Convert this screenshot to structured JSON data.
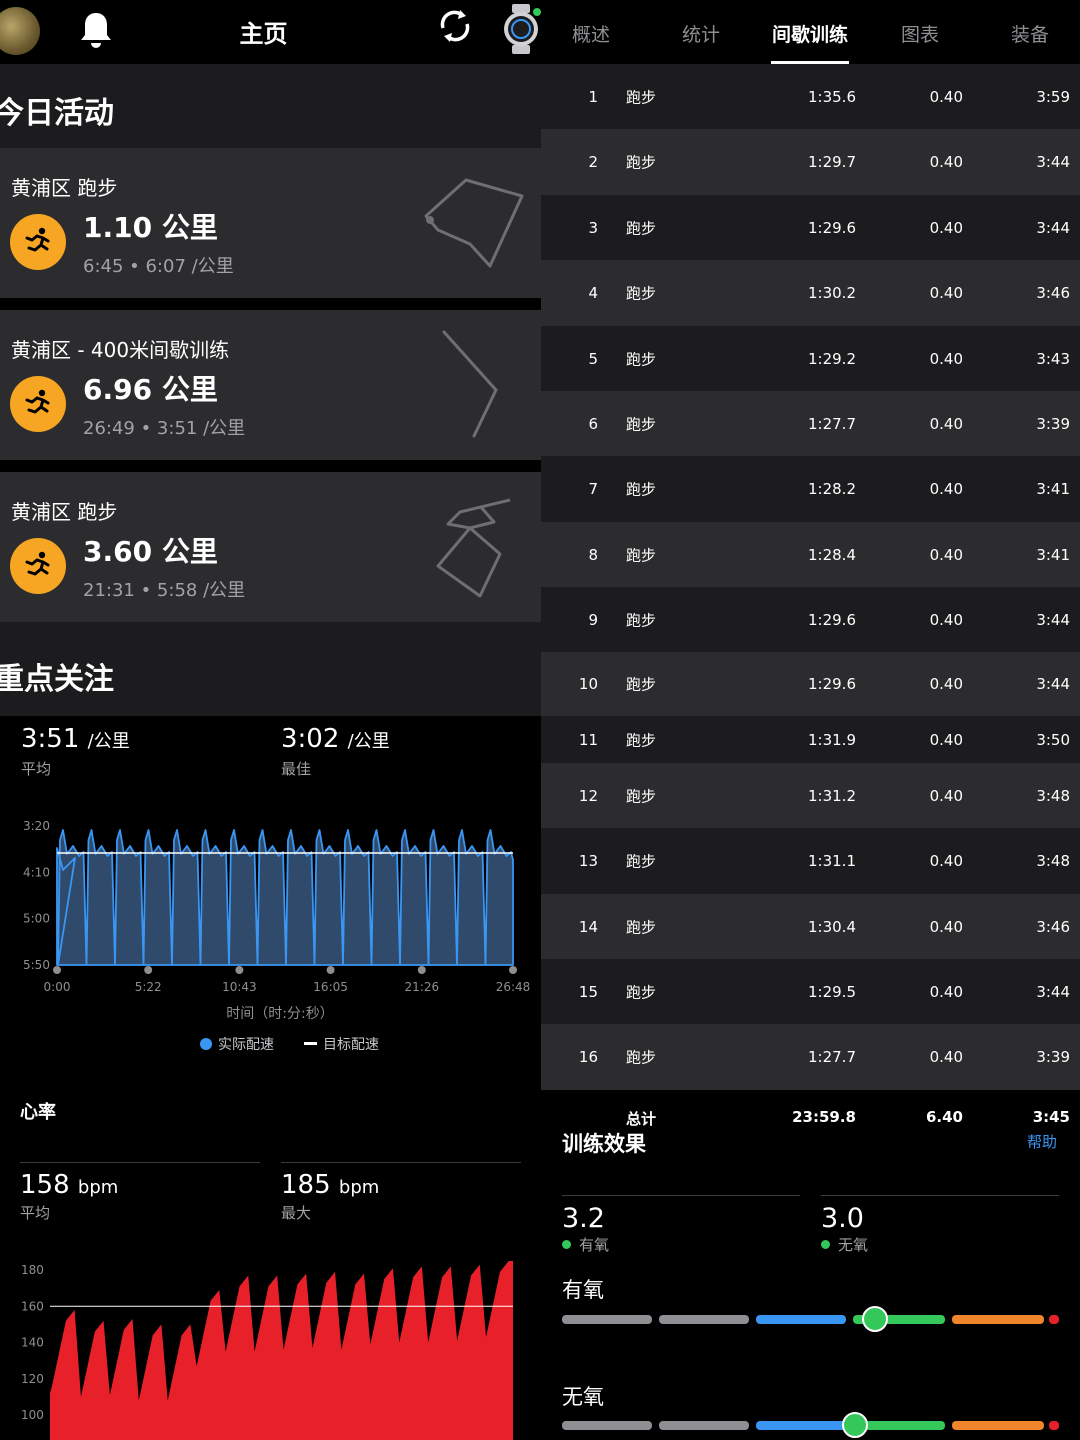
{
  "left": {
    "header": {
      "title": "主页"
    },
    "today": {
      "title": "今日活动",
      "activities": [
        {
          "name": "黄浦区 跑步",
          "distance": "1.10 公里",
          "meta": "6:45 • 6:07 /公里"
        },
        {
          "name": "黄浦区 - 400米间歇训练",
          "distance": "6.96 公里",
          "meta": "26:49 • 3:51 /公里"
        },
        {
          "name": "黄浦区 跑步",
          "distance": "3.60 公里",
          "meta": "21:31 • 5:58 /公里"
        }
      ]
    },
    "focus": {
      "title": "重点关注"
    },
    "pace": {
      "avg_value": "3:51",
      "avg_unit": "/公里",
      "avg_label": "平均",
      "best_value": "3:02",
      "best_unit": "/公里",
      "best_label": "最佳",
      "x_title": "时间（时:分:秒）",
      "legend_actual": "实际配速",
      "legend_target": "目标配速"
    },
    "heart": {
      "title": "心率",
      "avg_value": "158",
      "avg_unit": "bpm",
      "avg_label": "平均",
      "max_value": "185",
      "max_unit": "bpm",
      "max_label": "最大"
    }
  },
  "chart_data": [
    {
      "type": "area",
      "y_ticks": [
        "3:20",
        "4:10",
        "5:00",
        "5:50"
      ],
      "x_ticks": [
        "0:00",
        "5:22",
        "10:43",
        "16:05",
        "21:26",
        "26:48"
      ],
      "xlabel": "时间（时:分:秒）",
      "target_pace": "3:51",
      "series": [
        {
          "name": "实际配速",
          "color": "#3a96f3"
        },
        {
          "name": "目标配速",
          "color": "#ffffff"
        }
      ],
      "intervals": 16
    },
    {
      "type": "area",
      "y_ticks": [
        "180",
        "160",
        "140",
        "120",
        "100"
      ],
      "ylim": [
        100,
        180
      ],
      "reference_line": 160,
      "series": [
        {
          "name": "心率",
          "color": "#e8202a",
          "peaks": [
            158,
            152,
            153,
            150,
            150,
            169,
            177,
            177,
            178,
            179,
            178,
            181,
            182,
            182,
            183,
            185
          ]
        }
      ]
    }
  ],
  "right": {
    "tabs": [
      "概述",
      "统计",
      "间歇训练",
      "图表",
      "装备"
    ],
    "active_tab": "间歇训练",
    "laps": [
      {
        "num": "1",
        "type": "跑步",
        "time": "1:35.6",
        "dist": "0.40",
        "pace": "3:59"
      },
      {
        "num": "2",
        "type": "跑步",
        "time": "1:29.7",
        "dist": "0.40",
        "pace": "3:44"
      },
      {
        "num": "3",
        "type": "跑步",
        "time": "1:29.6",
        "dist": "0.40",
        "pace": "3:44"
      },
      {
        "num": "4",
        "type": "跑步",
        "time": "1:30.2",
        "dist": "0.40",
        "pace": "3:46"
      },
      {
        "num": "5",
        "type": "跑步",
        "time": "1:29.2",
        "dist": "0.40",
        "pace": "3:43"
      },
      {
        "num": "6",
        "type": "跑步",
        "time": "1:27.7",
        "dist": "0.40",
        "pace": "3:39"
      },
      {
        "num": "7",
        "type": "跑步",
        "time": "1:28.2",
        "dist": "0.40",
        "pace": "3:41"
      },
      {
        "num": "8",
        "type": "跑步",
        "time": "1:28.4",
        "dist": "0.40",
        "pace": "3:41"
      },
      {
        "num": "9",
        "type": "跑步",
        "time": "1:29.6",
        "dist": "0.40",
        "pace": "3:44"
      },
      {
        "num": "10",
        "type": "跑步",
        "time": "1:29.6",
        "dist": "0.40",
        "pace": "3:44"
      },
      {
        "num": "11",
        "type": "跑步",
        "time": "1:31.9",
        "dist": "0.40",
        "pace": "3:50"
      },
      {
        "num": "12",
        "type": "跑步",
        "time": "1:31.2",
        "dist": "0.40",
        "pace": "3:48"
      },
      {
        "num": "13",
        "type": "跑步",
        "time": "1:31.1",
        "dist": "0.40",
        "pace": "3:48"
      },
      {
        "num": "14",
        "type": "跑步",
        "time": "1:30.4",
        "dist": "0.40",
        "pace": "3:46"
      },
      {
        "num": "15",
        "type": "跑步",
        "time": "1:29.5",
        "dist": "0.40",
        "pace": "3:44"
      },
      {
        "num": "16",
        "type": "跑步",
        "time": "1:27.7",
        "dist": "0.40",
        "pace": "3:39"
      }
    ],
    "total": {
      "label": "总计",
      "time": "23:59.8",
      "dist": "6.40",
      "pace": "3:45"
    },
    "help": "帮助",
    "effect": {
      "title": "训练效果",
      "aerobic_value": "3.2",
      "aerobic_label": "有氧",
      "anaerobic_value": "3.0",
      "anaerobic_label": "无氧",
      "aerobic_title": "有氧",
      "anaerobic_title": "无氧",
      "aerobic_level": 3.2,
      "anaerobic_level": 3.0
    }
  },
  "colors": {
    "accent_blue": "#3a96f3",
    "activity_orange": "#f6a623",
    "card_bg": "#2c2c2e",
    "green": "#34c759",
    "heart_red": "#e8202a"
  }
}
